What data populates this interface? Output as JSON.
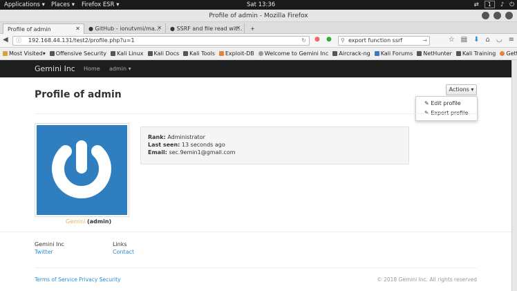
{
  "os": {
    "applications": "Applications ▾",
    "places": "Places ▾",
    "app_name": "Firefox ESR ▾",
    "clock": "Sat 13:36",
    "workspace": "1"
  },
  "window": {
    "title": "Profile of admin - Mozilla Firefox"
  },
  "tabs": [
    {
      "label": "Profile of admin"
    },
    {
      "label": "GitHub - ionutvmi/ma..."
    },
    {
      "label": "SSRF and file read wit..."
    }
  ],
  "url": {
    "value": "192.168.44.131/test2/profile.php?u=1"
  },
  "search": {
    "value": "export function ssrf"
  },
  "bookmarks": [
    {
      "label": "Most Visited▾"
    },
    {
      "label": "Offensive Security"
    },
    {
      "label": "Kali Linux"
    },
    {
      "label": "Kali Docs"
    },
    {
      "label": "Kali Tools"
    },
    {
      "label": "Exploit-DB"
    },
    {
      "label": "Welcome to Gemini Inc"
    },
    {
      "label": "Aircrack-ng"
    },
    {
      "label": "Kali Forums"
    },
    {
      "label": "NetHunter"
    },
    {
      "label": "Kali Training"
    },
    {
      "label": "Getting Started"
    }
  ],
  "app": {
    "brand": "Gemini Inc",
    "nav": [
      {
        "label": "Home"
      },
      {
        "label": "admin ▾"
      }
    ]
  },
  "profile": {
    "title": "Profile of admin",
    "actions_label": "Actions ▾",
    "actions_menu": [
      {
        "label": "Edit profile"
      },
      {
        "label": "Export profile"
      }
    ],
    "caption_name": "Gemini",
    "caption_role": "(admin)",
    "rank_label": "Rank:",
    "rank_value": "Administrator",
    "last_seen_label": "Last seen:",
    "last_seen_value": "13 seconds ago",
    "email_label": "Email:",
    "email_value": "sec.9emin1@gmail.com"
  },
  "footer": {
    "col1_head": "Gemini Inc",
    "col1_link": "Twitter",
    "col2_head": "Links",
    "col2_link": "Contact",
    "bottom_links": "Terms of Service Privacy Security",
    "copyright": "© 2018 Gemini Inc. All rights reserved"
  },
  "colors": {
    "brand_bar": "#1e1e1e",
    "avatar_bg": "#2f7fc0",
    "link": "#2a8bd4",
    "caption_name": "#f0ad4e"
  }
}
